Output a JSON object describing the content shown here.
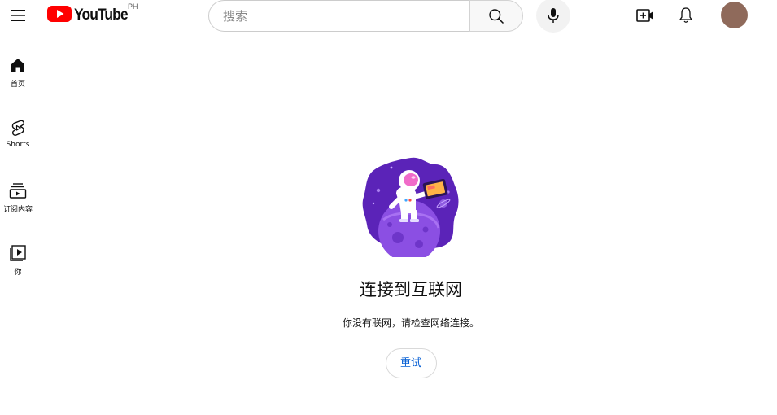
{
  "header": {
    "menu_icon": "hamburger-icon",
    "logo_text": "YouTube",
    "region_code": "PH",
    "search": {
      "placeholder": "搜索"
    },
    "icons": [
      "search-icon",
      "mic-icon",
      "create-video-icon",
      "bell-icon"
    ],
    "colors": {
      "brand_red": "#ff0000",
      "avatar": "#8f6a5b"
    }
  },
  "sidebar": {
    "items": [
      {
        "label": "首页",
        "icon": "home-icon"
      },
      {
        "label": "Shorts",
        "icon": "shorts-icon"
      },
      {
        "label": "订阅内容",
        "icon": "subscriptions-icon"
      },
      {
        "label": "你",
        "icon": "you-icon"
      }
    ]
  },
  "main": {
    "illustration": "astronaut-offline-icon",
    "title": "连接到互联网",
    "subtitle": "你没有联网，请检查网络连接。",
    "retry_label": "重试",
    "colors": {
      "link_blue": "#065fd4"
    }
  }
}
